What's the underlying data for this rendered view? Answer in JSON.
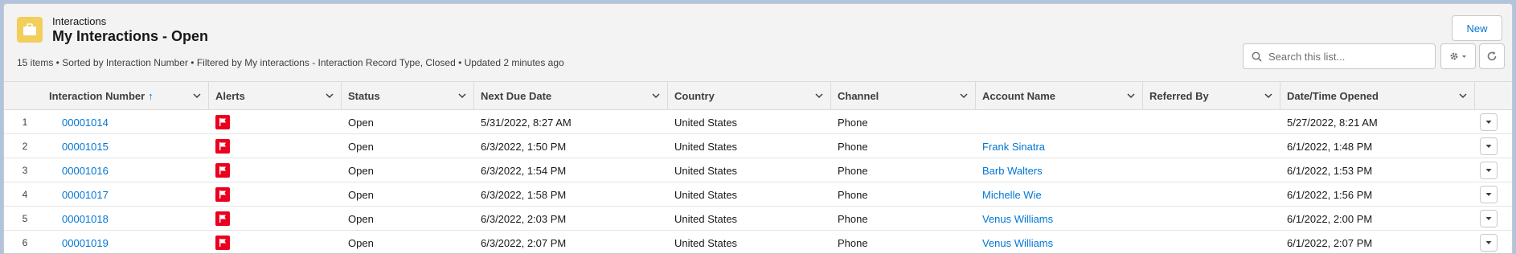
{
  "header": {
    "object_label": "Interactions",
    "title": "My Interactions - Open",
    "meta": "15 items • Sorted by Interaction Number • Filtered by My interactions - Interaction Record Type, Closed • Updated 2 minutes ago",
    "new_button": "New",
    "search_placeholder": "Search this list..."
  },
  "columns": [
    "Interaction Number",
    "Alerts",
    "Status",
    "Next Due Date",
    "Country",
    "Channel",
    "Account Name",
    "Referred By",
    "Date/Time Opened"
  ],
  "sort_indicator": "↑",
  "rows": [
    {
      "n": "1",
      "number": "00001014",
      "status": "Open",
      "due": "5/31/2022, 8:27 AM",
      "country": "United States",
      "channel": "Phone",
      "account": "",
      "referred": "",
      "opened": "5/27/2022, 8:21 AM"
    },
    {
      "n": "2",
      "number": "00001015",
      "status": "Open",
      "due": "6/3/2022, 1:50 PM",
      "country": "United States",
      "channel": "Phone",
      "account": "Frank Sinatra",
      "referred": "",
      "opened": "6/1/2022, 1:48 PM"
    },
    {
      "n": "3",
      "number": "00001016",
      "status": "Open",
      "due": "6/3/2022, 1:54 PM",
      "country": "United States",
      "channel": "Phone",
      "account": "Barb Walters",
      "referred": "",
      "opened": "6/1/2022, 1:53 PM"
    },
    {
      "n": "4",
      "number": "00001017",
      "status": "Open",
      "due": "6/3/2022, 1:58 PM",
      "country": "United States",
      "channel": "Phone",
      "account": "Michelle Wie",
      "referred": "",
      "opened": "6/1/2022, 1:56 PM"
    },
    {
      "n": "5",
      "number": "00001018",
      "status": "Open",
      "due": "6/3/2022, 2:03 PM",
      "country": "United States",
      "channel": "Phone",
      "account": "Venus Williams",
      "referred": "",
      "opened": "6/1/2022, 2:00 PM"
    },
    {
      "n": "6",
      "number": "00001019",
      "status": "Open",
      "due": "6/3/2022, 2:07 PM",
      "country": "United States",
      "channel": "Phone",
      "account": "Venus Williams",
      "referred": "",
      "opened": "6/1/2022, 2:07 PM"
    }
  ],
  "colors": {
    "accent": "#0176d3",
    "alert_flag": "#ea001e",
    "object_icon": "#f2cf5b"
  },
  "icons": {
    "object": "briefcase-icon",
    "alert": "flag-icon",
    "search": "search-icon",
    "settings": "gear-icon",
    "refresh": "refresh-icon",
    "row_action": "chevron-down-icon"
  }
}
